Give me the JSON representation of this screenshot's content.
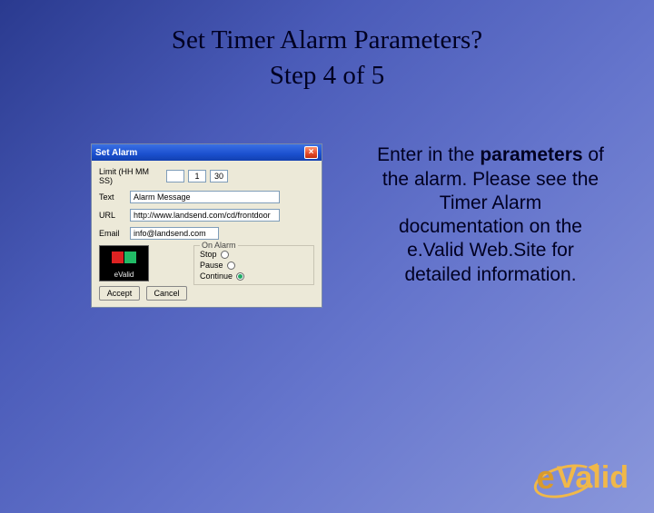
{
  "title_line1": "Set Timer Alarm Parameters?",
  "title_line2": "Step 4 of 5",
  "body": {
    "lead": "Enter in the ",
    "bold": "parameters",
    "rest": " of the alarm. Please see the Timer Alarm documentation on the e.Valid Web.Site for detailed information."
  },
  "dialog": {
    "title": "Set Alarm",
    "limit_label": "Limit (HH MM SS)",
    "limit_hh": "",
    "limit_mm": "1",
    "limit_ss": "30",
    "text_label": "Text",
    "text_value": "Alarm Message",
    "url_label": "URL",
    "url_value": "http://www.landsend.com/cd/frontdoor",
    "email_label": "Email",
    "email_value": "info@landsend.com",
    "onalarm_label": "On Alarm",
    "stop": "Stop",
    "pause": "Pause",
    "cont": "Continue",
    "accept": "Accept",
    "cancel": "Cancel",
    "badge": "eValid"
  },
  "logo": {
    "e": "e",
    "valid": "Valid"
  }
}
